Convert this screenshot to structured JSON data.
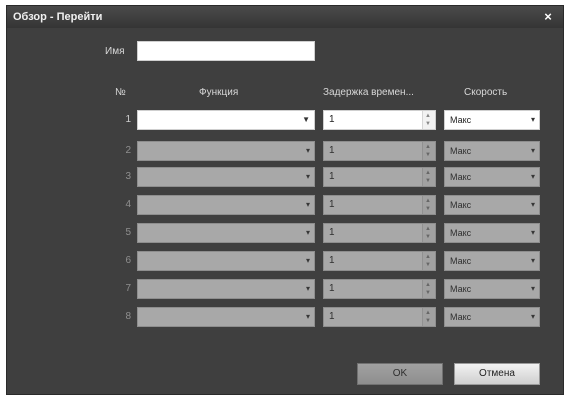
{
  "dialog": {
    "title": "Обзор - Перейти",
    "close_symbol": "×"
  },
  "name_field": {
    "label": "Имя",
    "value": ""
  },
  "table": {
    "headers": {
      "number": "№",
      "function": "Функция",
      "delay": "Задержка времен...",
      "speed": "Скорость"
    },
    "rows": [
      {
        "number": "1",
        "function": "",
        "delay": "1",
        "speed": "Макс"
      },
      {
        "number": "2",
        "function": "",
        "delay": "1",
        "speed": "Макс"
      },
      {
        "number": "3",
        "function": "",
        "delay": "1",
        "speed": "Макс"
      },
      {
        "number": "4",
        "function": "",
        "delay": "1",
        "speed": "Макс"
      },
      {
        "number": "5",
        "function": "",
        "delay": "1",
        "speed": "Макс"
      },
      {
        "number": "6",
        "function": "",
        "delay": "1",
        "speed": "Макс"
      },
      {
        "number": "7",
        "function": "",
        "delay": "1",
        "speed": "Макс"
      },
      {
        "number": "8",
        "function": "",
        "delay": "1",
        "speed": "Макс"
      }
    ]
  },
  "buttons": {
    "ok": "OK",
    "cancel": "Отмена"
  }
}
